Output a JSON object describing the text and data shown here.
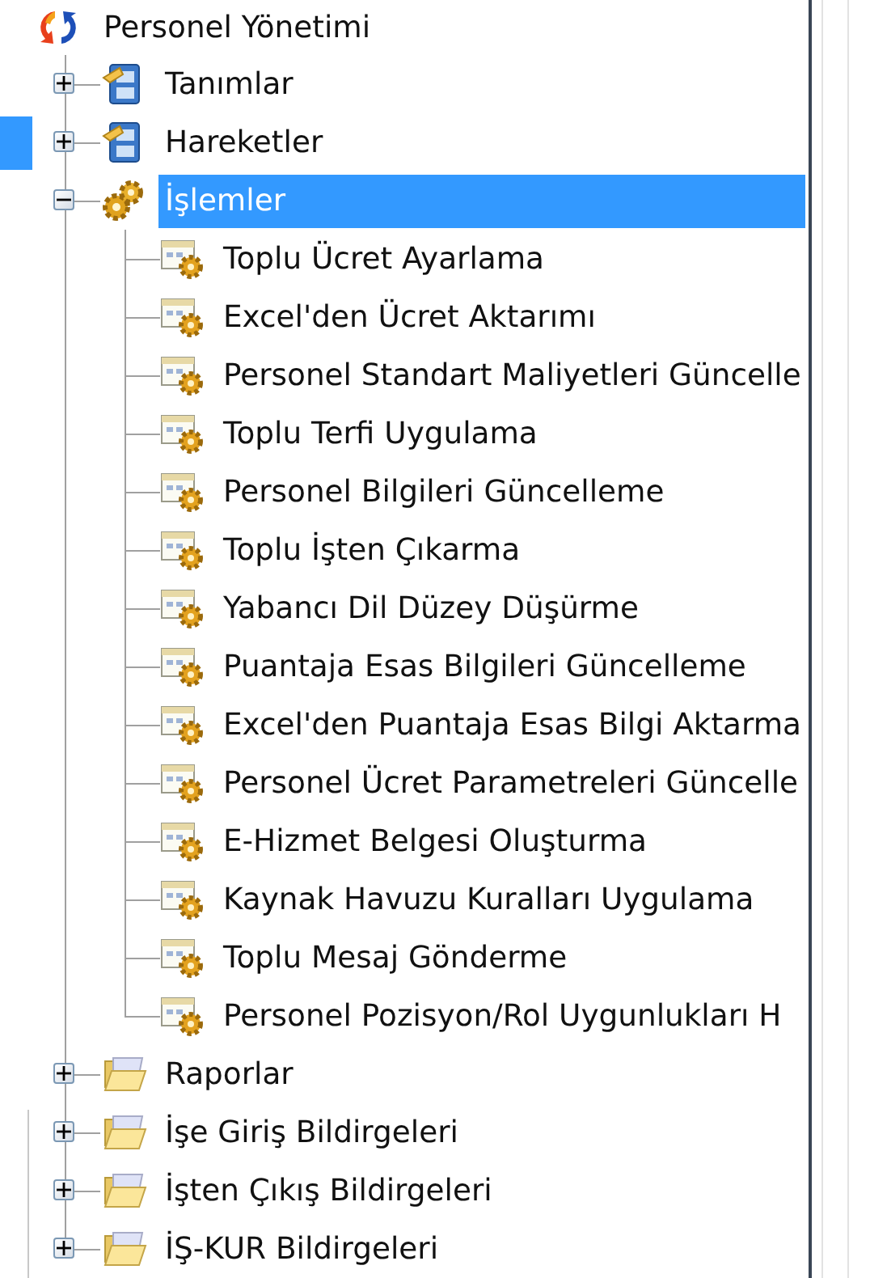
{
  "tree": {
    "label": "Personel Yönetimi",
    "kind": "root",
    "selected": false,
    "children": [
      {
        "label": "Tanımlar",
        "kind": "cabinet",
        "expanded": false,
        "selected": false
      },
      {
        "label": "Hareketler",
        "kind": "cabinet",
        "expanded": false,
        "selected": false
      },
      {
        "label": "İşlemler",
        "kind": "gears",
        "expanded": true,
        "selected": true,
        "children": [
          {
            "label": "Toplu Ücret Ayarlama",
            "kind": "task",
            "selected": false
          },
          {
            "label": "Excel'den Ücret Aktarımı",
            "kind": "task",
            "selected": false
          },
          {
            "label": "Personel Standart Maliyetleri Güncelle",
            "kind": "task",
            "selected": false
          },
          {
            "label": "Toplu Terfi Uygulama",
            "kind": "task",
            "selected": false
          },
          {
            "label": "Personel Bilgileri Güncelleme",
            "kind": "task",
            "selected": false
          },
          {
            "label": "Toplu İşten Çıkarma",
            "kind": "task",
            "selected": false
          },
          {
            "label": "Yabancı Dil Düzey Düşürme",
            "kind": "task",
            "selected": false
          },
          {
            "label": "Puantaja Esas Bilgileri Güncelleme",
            "kind": "task",
            "selected": false
          },
          {
            "label": "Excel'den Puantaja Esas Bilgi Aktarma",
            "kind": "task",
            "selected": false
          },
          {
            "label": "Personel Ücret Parametreleri Güncelle",
            "kind": "task",
            "selected": false
          },
          {
            "label": "E-Hizmet Belgesi Oluşturma",
            "kind": "task",
            "selected": false
          },
          {
            "label": "Kaynak Havuzu Kuralları Uygulama",
            "kind": "task",
            "selected": false
          },
          {
            "label": "Toplu Mesaj Gönderme",
            "kind": "task",
            "selected": false
          },
          {
            "label": "Personel Pozisyon/Rol Uygunlukları H",
            "kind": "task",
            "selected": false
          }
        ]
      },
      {
        "label": "Raporlar",
        "kind": "folder",
        "expanded": false,
        "selected": false
      },
      {
        "label": "İşe Giriş Bildirgeleri",
        "kind": "folder",
        "expanded": false,
        "selected": false
      },
      {
        "label": "İşten Çıkış Bildirgeleri",
        "kind": "folder",
        "expanded": false,
        "selected": false
      },
      {
        "label": "İŞ-KUR Bildirgeleri",
        "kind": "folder",
        "expanded": false,
        "selected": false
      }
    ]
  }
}
